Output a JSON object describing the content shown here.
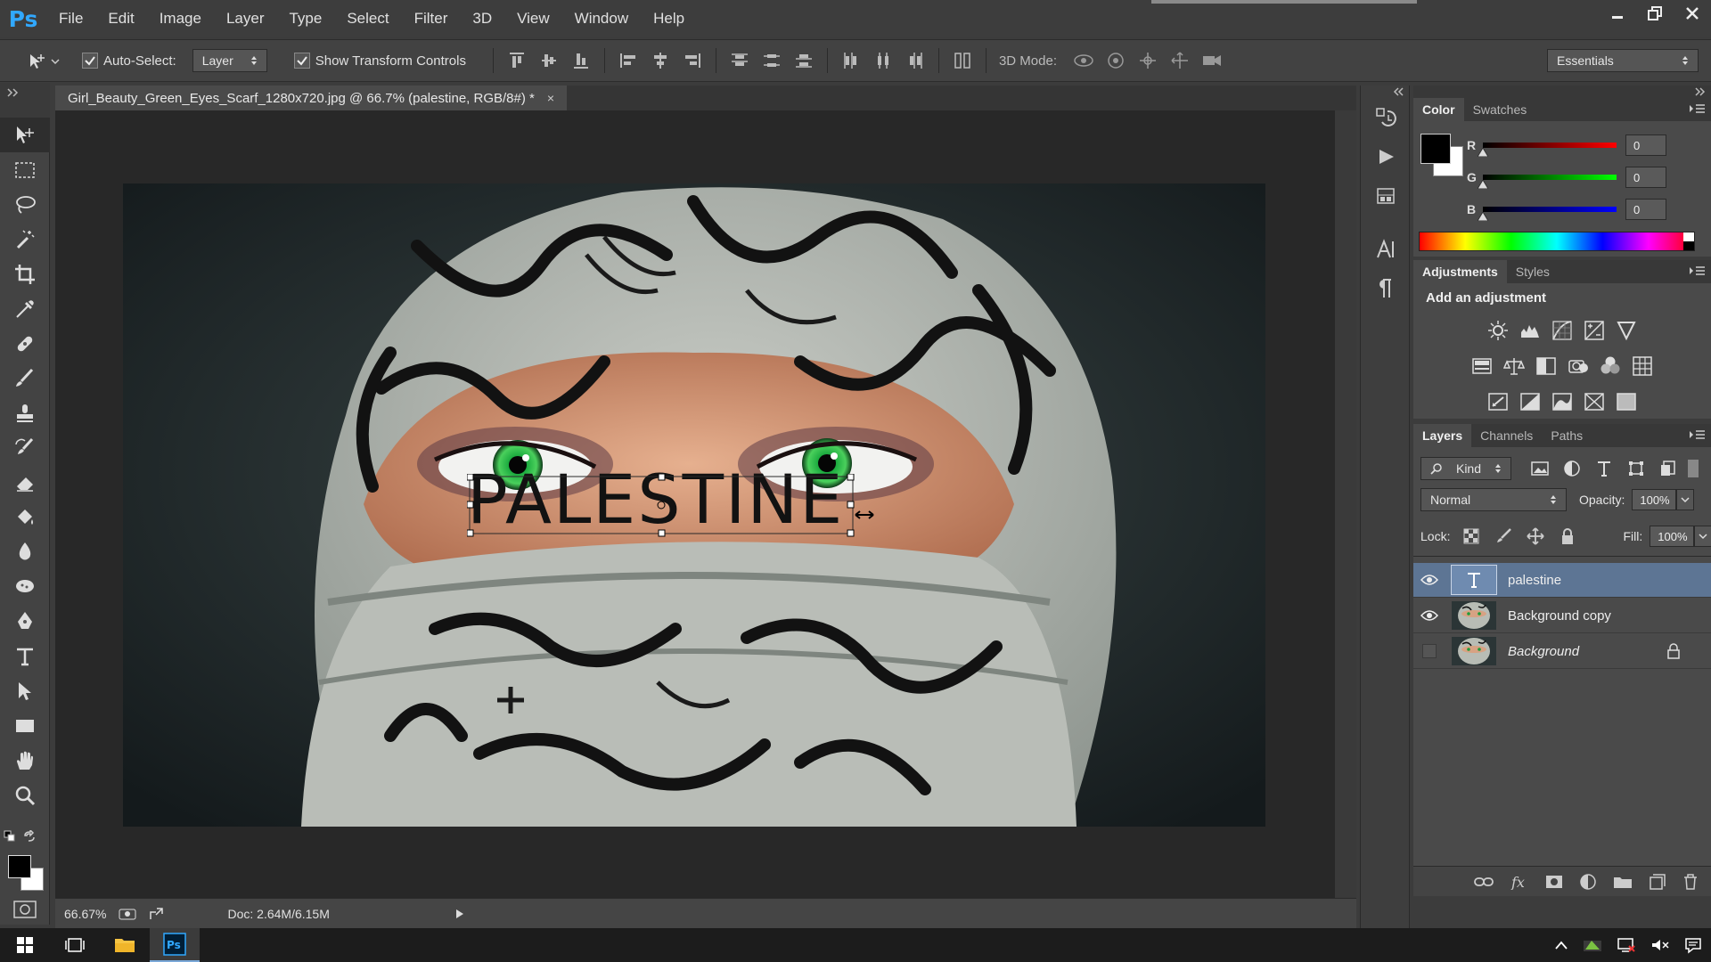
{
  "app": {
    "logo": "Ps",
    "menu": [
      "File",
      "Edit",
      "Image",
      "Layer",
      "Type",
      "Select",
      "Filter",
      "3D",
      "View",
      "Window",
      "Help"
    ]
  },
  "options": {
    "auto_select_label": "Auto-Select:",
    "auto_select_target": "Layer",
    "show_transform_label": "Show Transform Controls",
    "mode3d_label": "3D Mode:",
    "workspace": "Essentials"
  },
  "document": {
    "tab_title": "Girl_Beauty_Green_Eyes_Scarf_1280x720.jpg @ 66.7% (palestine, RGB/8#) *",
    "close": "×",
    "text_layer_content": "PALESTINE",
    "zoom": "66.67%",
    "doc_info": "Doc: 2.64M/6.15M"
  },
  "color_panel": {
    "tabs": [
      "Color",
      "Swatches"
    ],
    "channels": [
      {
        "label": "R",
        "value": "0"
      },
      {
        "label": "G",
        "value": "0"
      },
      {
        "label": "B",
        "value": "0"
      }
    ]
  },
  "adjustments_panel": {
    "tabs": [
      "Adjustments",
      "Styles"
    ],
    "title": "Add an adjustment"
  },
  "layers_panel": {
    "tabs": [
      "Layers",
      "Channels",
      "Paths"
    ],
    "filter_kind": "Kind",
    "blend_mode": "Normal",
    "opacity_label": "Opacity:",
    "opacity": "100%",
    "lock_label": "Lock:",
    "fill_label": "Fill:",
    "fill": "100%",
    "layers": [
      {
        "name": "palestine",
        "type": "text",
        "visible": true,
        "selected": true
      },
      {
        "name": "Background copy",
        "type": "image",
        "visible": true,
        "selected": false
      },
      {
        "name": "Background",
        "type": "image",
        "visible": false,
        "selected": false,
        "locked": true
      }
    ]
  },
  "colors": {
    "accent_blue": "#31a8ff",
    "selected_layer": "#5d7594",
    "panel_bg": "#4a4a4a",
    "canvas_bg": "#282828"
  }
}
